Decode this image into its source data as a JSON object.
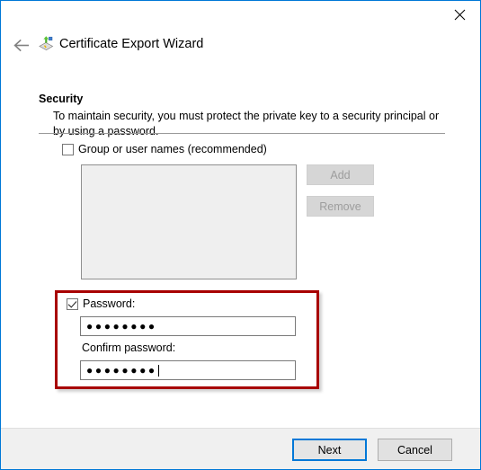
{
  "window": {
    "title": "Certificate Export Wizard",
    "accent_color": "#0078d7",
    "close_icon": "close-icon",
    "back_icon": "back-arrow-icon",
    "wizard_icon": "certificate-export-icon"
  },
  "page": {
    "heading": "Security",
    "description": "To maintain security, you must protect the private key to a security principal or by using a password."
  },
  "group_names": {
    "checkbox_label": "Group or user names (recommended)",
    "checked": false,
    "list_items": [],
    "add_label": "Add",
    "remove_label": "Remove",
    "add_enabled": false,
    "remove_enabled": false
  },
  "password_section": {
    "highlight_color": "#a80000",
    "password_checkbox_label": "Password:",
    "password_checked": true,
    "password_value": "●●●●●●●●",
    "confirm_label": "Confirm password:",
    "confirm_value": "●●●●●●●●",
    "confirm_focused": true
  },
  "footer": {
    "next_label": "Next",
    "cancel_label": "Cancel",
    "default_button": "Next"
  }
}
